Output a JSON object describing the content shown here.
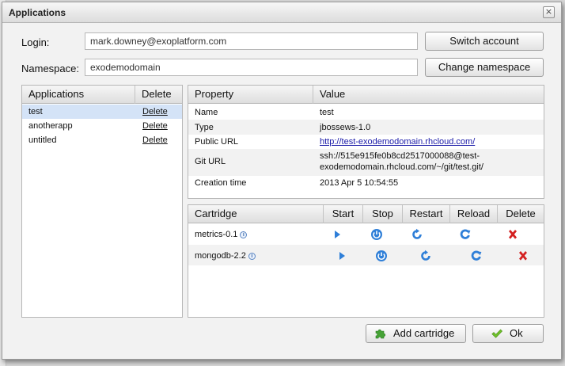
{
  "window": {
    "title": "Applications",
    "close_glyph": "×"
  },
  "form": {
    "login_label": "Login:",
    "login_value": "mark.downey@exoplatform.com",
    "namespace_label": "Namespace:",
    "namespace_value": "exodemodomain",
    "switch_account_label": "Switch account",
    "change_namespace_label": "Change namespace"
  },
  "apps": {
    "columns": [
      "Applications",
      "Delete"
    ],
    "rows": [
      {
        "name": "test",
        "action": "Delete",
        "selected": true
      },
      {
        "name": "anotherapp",
        "action": "Delete",
        "selected": false
      },
      {
        "name": "untitled",
        "action": "Delete",
        "selected": false
      }
    ]
  },
  "properties": {
    "columns": [
      "Property",
      "Value"
    ],
    "rows": [
      {
        "property": "Name",
        "value": "test"
      },
      {
        "property": "Type",
        "value": "jbossews-1.0"
      },
      {
        "property": "Public URL",
        "value": "http://test-exodemodomain.rhcloud.com/"
      },
      {
        "property": "Git URL",
        "value_line1": "ssh://515e915fe0b8cd2517000088@test-",
        "value_line2": "exodemodomain.rhcloud.com/~/git/test.git/"
      },
      {
        "property": "Creation time",
        "value": "2013 Apr 5 10:54:55"
      }
    ]
  },
  "cartridges": {
    "columns": [
      "Cartridge",
      "Start",
      "Stop",
      "Restart",
      "Reload",
      "Delete"
    ],
    "rows": [
      {
        "name": "metrics-0.1"
      },
      {
        "name": "mongodb-2.2"
      }
    ],
    "info_glyph": "i",
    "icons": [
      "play-icon",
      "power-icon",
      "restart-icon",
      "reload-icon",
      "delete-x-icon"
    ]
  },
  "footer": {
    "add_cartridge_label": "Add cartridge",
    "ok_label": "Ok"
  },
  "colors": {
    "selected_row": "#d4e3f7",
    "link_blue": "#1a1aa8",
    "delete_red": "#d42020",
    "action_blue": "#2f7fd8",
    "ok_green": "#6fc12a",
    "puzzle_green": "#45a235"
  }
}
